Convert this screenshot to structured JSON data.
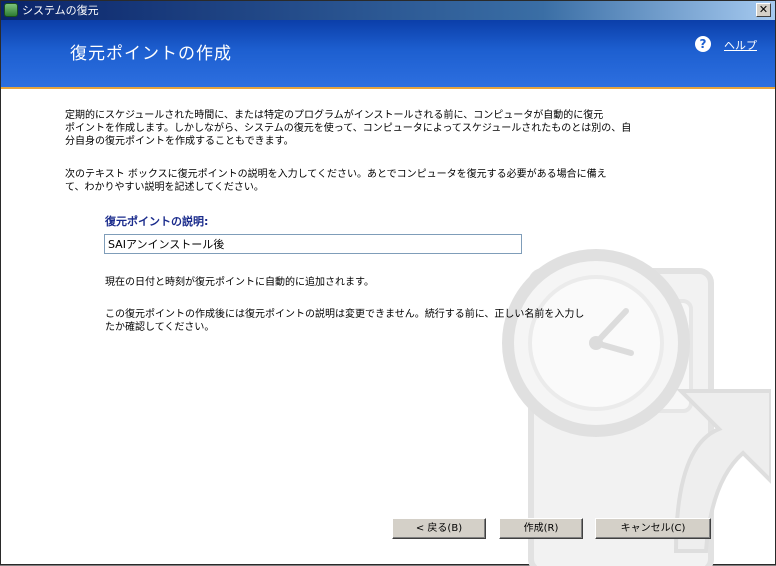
{
  "window": {
    "title": "システムの復元",
    "close_label": "✕"
  },
  "header": {
    "title": "復元ポイントの作成",
    "help_label": "ヘルプ",
    "help_icon": "?"
  },
  "content": {
    "intro_lines": [
      "定期的にスケジュールされた時間に、または特定のプログラムがインストールされる前に、コンピュータが自動的に復元",
      "ポイントを作成します。しかしながら、システムの復元を使って、コンピュータによってスケジュールされたものとは別の、自",
      "分自身の復元ポイントを作成することもできます。"
    ],
    "instruction_lines": [
      "次のテキスト ボックスに復元ポイントの説明を入力してください。あとでコンピュータを復元する必要がある場合に備え",
      "て、わかりやすい説明を記述してください。"
    ],
    "description_label": "復元ポイントの説明:",
    "description_value": "SAIアンインストール後",
    "auto_date_note": "現在の日付と時刻が復元ポイントに自動的に追加されます。",
    "warning_lines": [
      "この復元ポイントの作成後には復元ポイントの説明は変更できません。続行する前に、正しい名前を入力し",
      "たか確認してください。"
    ]
  },
  "buttons": {
    "back": "< 戻る(B)",
    "create": "作成(R)",
    "cancel": "キャンセル(C)"
  },
  "colors": {
    "header_blue": "#1d5fd0",
    "header_stripe": "#e7a43c",
    "label_blue": "#1a2b8c"
  }
}
